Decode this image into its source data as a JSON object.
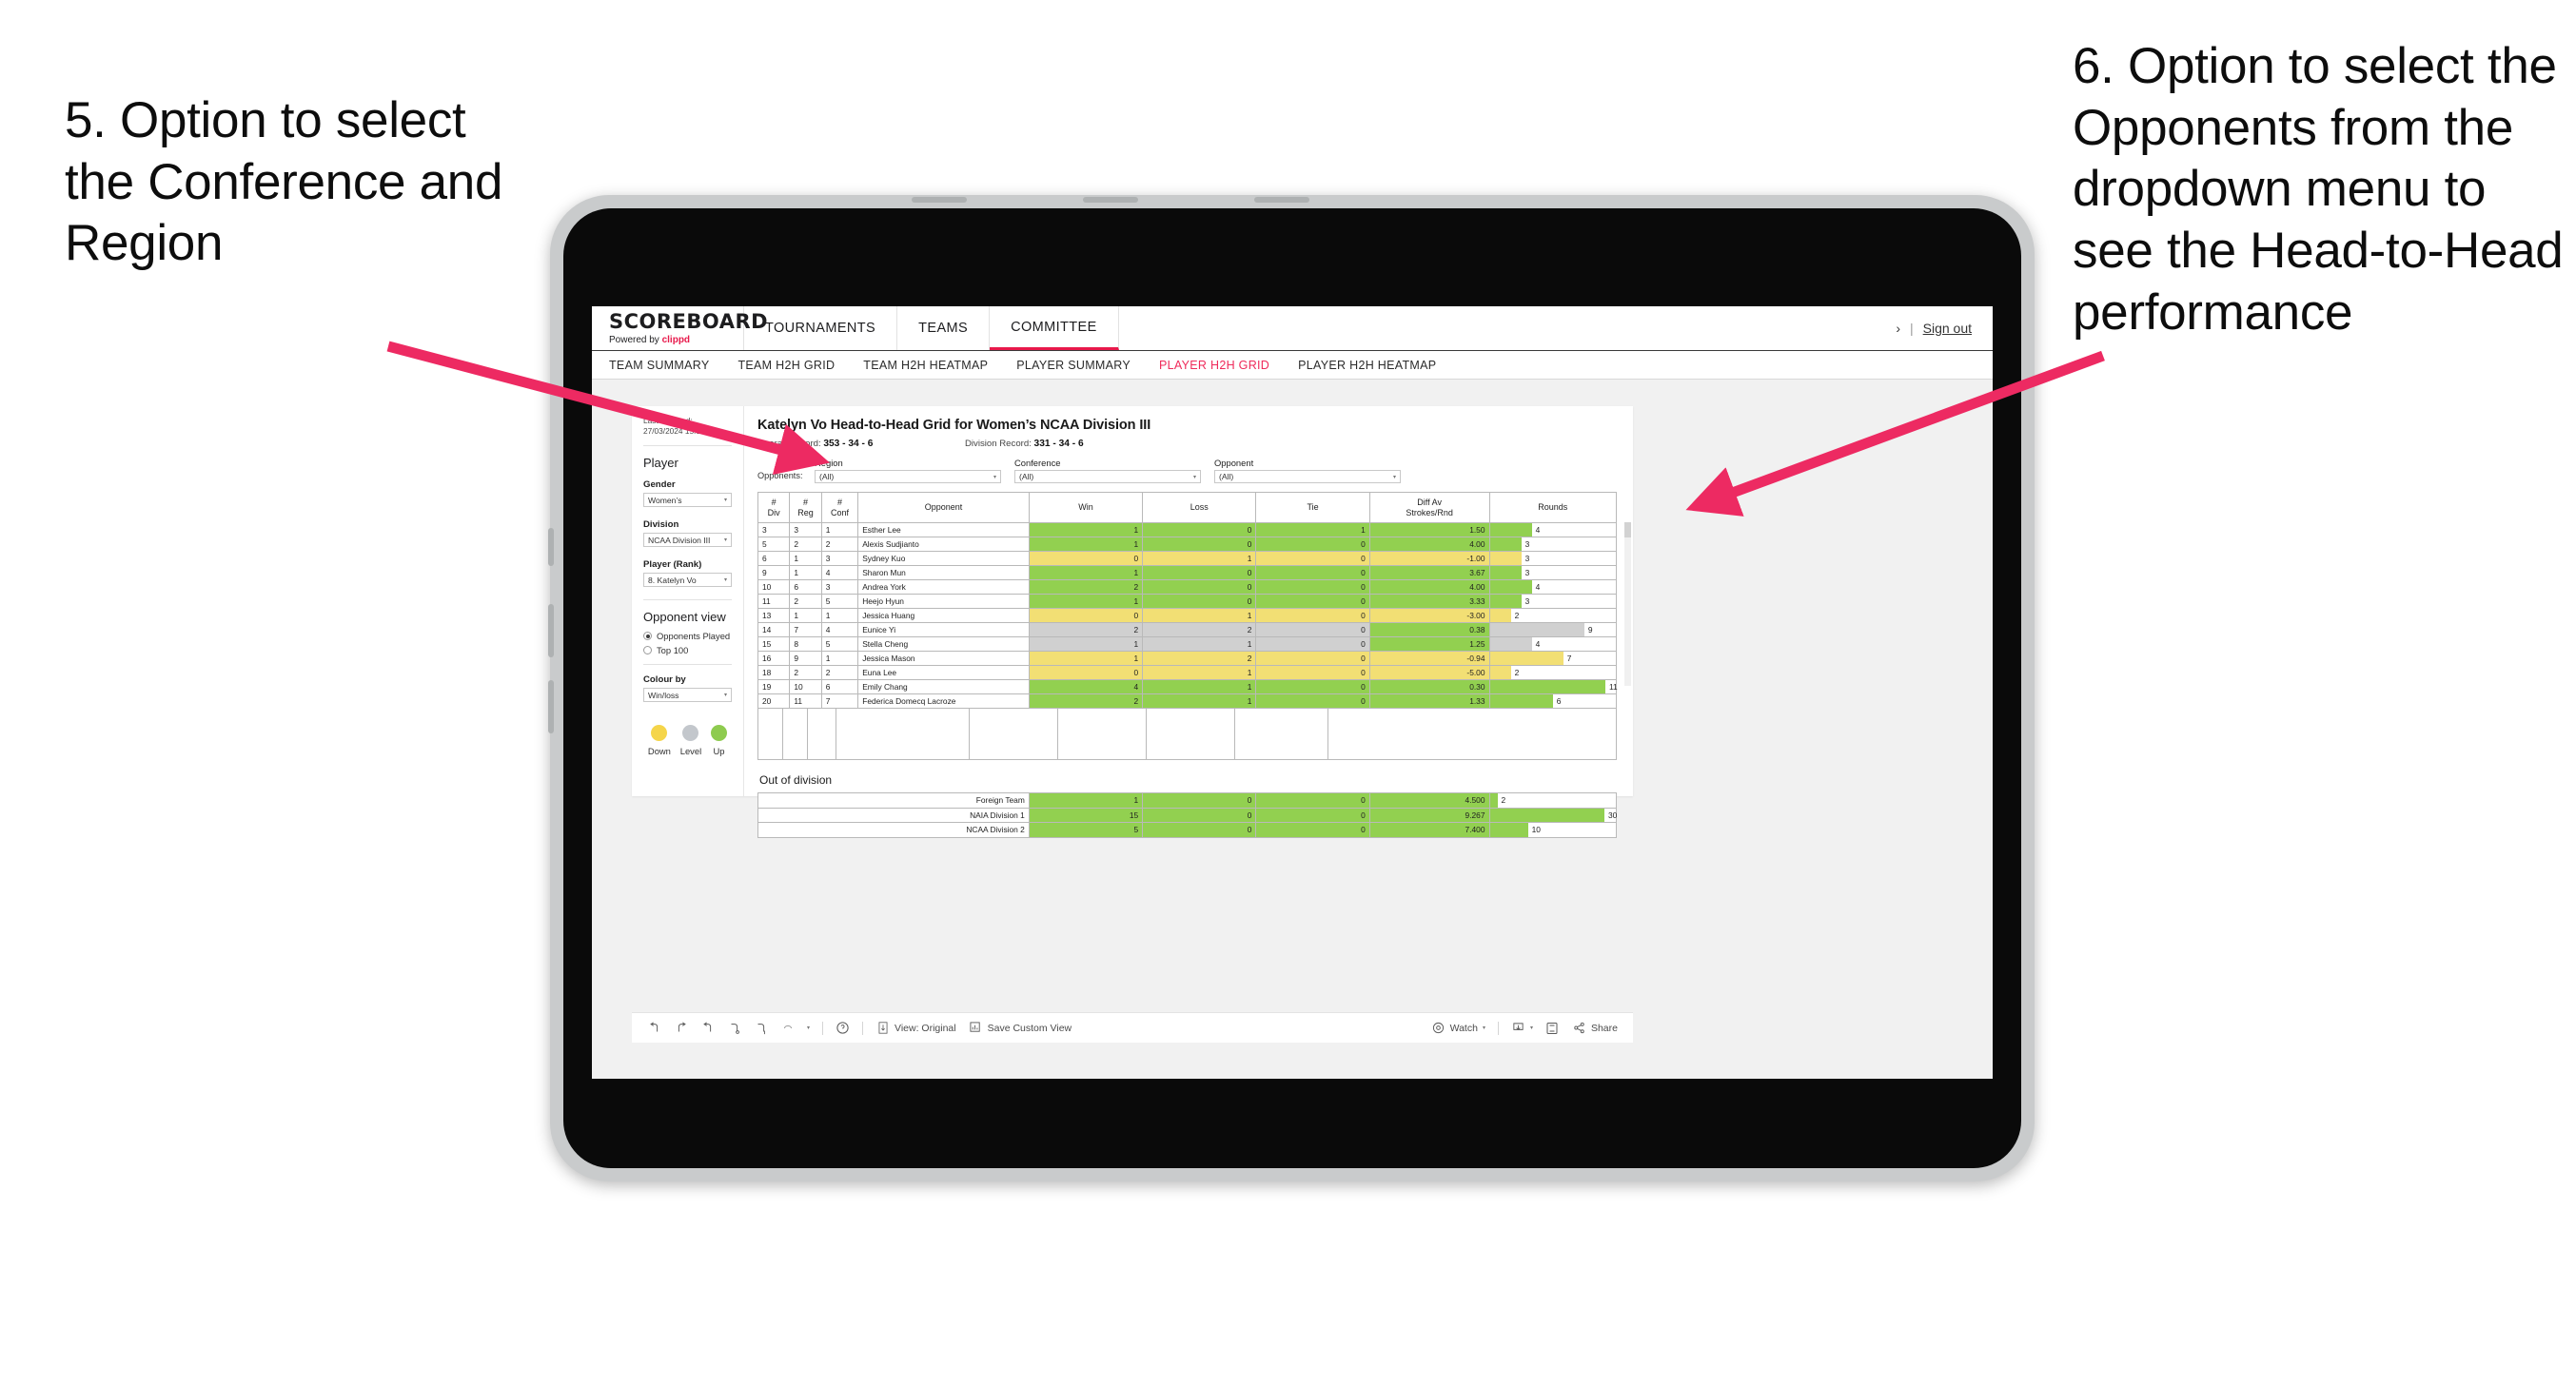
{
  "annotations": {
    "left": "5. Option to select the Conference and Region",
    "right": "6. Option to select the Opponents from the dropdown menu to see the Head-to-Head performance"
  },
  "colors": {
    "accent_pink": "#e8194b",
    "arrow_pink": "#ed2a62",
    "green": "#92d050",
    "yellow": "#f2df74",
    "grey": "#d0d0d0"
  },
  "topnav": {
    "brand_title": "SCOREBOARD",
    "brand_sub_prefix": "Powered by ",
    "brand_sub_name": "clippd",
    "items": [
      {
        "label": "TOURNAMENTS",
        "active": false
      },
      {
        "label": "TEAMS",
        "active": false
      },
      {
        "label": "COMMITTEE",
        "active": true
      }
    ],
    "chevron": "›",
    "separator": "|",
    "signout": "Sign out"
  },
  "subnav": {
    "items": [
      {
        "label": "TEAM SUMMARY",
        "active": false
      },
      {
        "label": "TEAM H2H GRID",
        "active": false
      },
      {
        "label": "TEAM H2H HEATMAP",
        "active": false
      },
      {
        "label": "PLAYER SUMMARY",
        "active": false
      },
      {
        "label": "PLAYER H2H GRID",
        "active": true
      },
      {
        "label": "PLAYER H2H HEATMAP",
        "active": false
      }
    ]
  },
  "sidebar": {
    "last_updated": "Last Updated: 27/03/2024 15:38",
    "player_heading": "Player",
    "gender_label": "Gender",
    "gender_value": "Women’s",
    "division_label": "Division",
    "division_value": "NCAA Division III",
    "player_rank_label": "Player (Rank)",
    "player_rank_value": "8. Katelyn Vo",
    "opponent_view_heading": "Opponent view",
    "opponent_view_options": [
      {
        "label": "Opponents Played",
        "selected": true
      },
      {
        "label": "Top 100",
        "selected": false
      }
    ],
    "colour_by_label": "Colour by",
    "colour_by_value": "Win/loss",
    "legend": [
      {
        "label": "Down",
        "color": "#f5d54a"
      },
      {
        "label": "Level",
        "color": "#c3c7cc"
      },
      {
        "label": "Up",
        "color": "#8ecb4f"
      }
    ],
    "caret": "▾"
  },
  "main": {
    "title": "Katelyn Vo Head-to-Head Grid for Women’s NCAA Division III",
    "overall_record_label": "Overall Record:",
    "overall_record_value": "353 - 34 - 6",
    "division_record_label": "Division Record:",
    "division_record_value": "331 -  34 - 6",
    "opponents_label": "Opponents:",
    "filters": [
      {
        "label": "Region",
        "value": "(All)"
      },
      {
        "label": "Conference",
        "value": "(All)"
      },
      {
        "label": "Opponent",
        "value": "(All)"
      }
    ],
    "out_of_division_title": "Out of division"
  },
  "chart_data": {
    "type": "table",
    "title": "Katelyn Vo Head-to-Head Grid for Women’s NCAA Division III",
    "columns": [
      "# Div",
      "# Reg",
      "# Conf",
      "Opponent",
      "Win",
      "Loss",
      "Tie",
      "Diff Av Strokes/Rnd",
      "Rounds"
    ],
    "column_headers_multiline": [
      {
        "l1": "#",
        "l2": "Div"
      },
      {
        "l1": "#",
        "l2": "Reg"
      },
      {
        "l1": "#",
        "l2": "Conf"
      },
      {
        "l1": "Opponent",
        "l2": ""
      },
      {
        "l1": "Win",
        "l2": ""
      },
      {
        "l1": "Loss",
        "l2": ""
      },
      {
        "l1": "Tie",
        "l2": ""
      },
      {
        "l1": "Diff Av",
        "l2": "Strokes/Rnd"
      },
      {
        "l1": "Rounds",
        "l2": ""
      }
    ],
    "rounds_max": 12,
    "rows": [
      {
        "div": "3",
        "reg": "3",
        "conf": "1",
        "opponent": "Esther Lee",
        "win": "1",
        "loss": "0",
        "tie": "1",
        "diff": "1.50",
        "rounds": "4",
        "rounds_n": 4,
        "color": "green"
      },
      {
        "div": "5",
        "reg": "2",
        "conf": "2",
        "opponent": "Alexis Sudjianto",
        "win": "1",
        "loss": "0",
        "tie": "0",
        "diff": "4.00",
        "rounds": "3",
        "rounds_n": 3,
        "color": "green"
      },
      {
        "div": "6",
        "reg": "1",
        "conf": "3",
        "opponent": "Sydney Kuo",
        "win": "0",
        "loss": "1",
        "tie": "0",
        "diff": "-1.00",
        "rounds": "3",
        "rounds_n": 3,
        "color": "yellow"
      },
      {
        "div": "9",
        "reg": "1",
        "conf": "4",
        "opponent": "Sharon Mun",
        "win": "1",
        "loss": "0",
        "tie": "0",
        "diff": "3.67",
        "rounds": "3",
        "rounds_n": 3,
        "color": "green"
      },
      {
        "div": "10",
        "reg": "6",
        "conf": "3",
        "opponent": "Andrea York",
        "win": "2",
        "loss": "0",
        "tie": "0",
        "diff": "4.00",
        "rounds": "4",
        "rounds_n": 4,
        "color": "green"
      },
      {
        "div": "11",
        "reg": "2",
        "conf": "5",
        "opponent": "Heejo Hyun",
        "win": "1",
        "loss": "0",
        "tie": "0",
        "diff": "3.33",
        "rounds": "3",
        "rounds_n": 3,
        "color": "green"
      },
      {
        "div": "13",
        "reg": "1",
        "conf": "1",
        "opponent": "Jessica Huang",
        "win": "0",
        "loss": "1",
        "tie": "0",
        "diff": "-3.00",
        "rounds": "2",
        "rounds_n": 2,
        "color": "yellow"
      },
      {
        "div": "14",
        "reg": "7",
        "conf": "4",
        "opponent": "Eunice Yi",
        "win": "2",
        "loss": "2",
        "tie": "0",
        "diff": "0.38",
        "rounds": "9",
        "rounds_n": 9,
        "color": "grey",
        "diff_color": "green"
      },
      {
        "div": "15",
        "reg": "8",
        "conf": "5",
        "opponent": "Stella Cheng",
        "win": "1",
        "loss": "1",
        "tie": "0",
        "diff": "1.25",
        "rounds": "4",
        "rounds_n": 4,
        "color": "grey",
        "diff_color": "green"
      },
      {
        "div": "16",
        "reg": "9",
        "conf": "1",
        "opponent": "Jessica Mason",
        "win": "1",
        "loss": "2",
        "tie": "0",
        "diff": "-0.94",
        "rounds": "7",
        "rounds_n": 7,
        "color": "yellow"
      },
      {
        "div": "18",
        "reg": "2",
        "conf": "2",
        "opponent": "Euna Lee",
        "win": "0",
        "loss": "1",
        "tie": "0",
        "diff": "-5.00",
        "rounds": "2",
        "rounds_n": 2,
        "color": "yellow"
      },
      {
        "div": "19",
        "reg": "10",
        "conf": "6",
        "opponent": "Emily Chang",
        "win": "4",
        "loss": "1",
        "tie": "0",
        "diff": "0.30",
        "rounds": "11",
        "rounds_n": 11,
        "color": "green"
      },
      {
        "div": "20",
        "reg": "11",
        "conf": "7",
        "opponent": "Federica Domecq Lacroze",
        "win": "2",
        "loss": "1",
        "tie": "0",
        "diff": "1.33",
        "rounds": "6",
        "rounds_n": 6,
        "color": "green"
      }
    ],
    "out_of_division_rows": [
      {
        "name": "Foreign Team",
        "win": "1",
        "loss": "0",
        "tie": "0",
        "diff": "4.500",
        "rounds": "2",
        "rounds_n": 2,
        "color": "green"
      },
      {
        "name": "NAIA Division 1",
        "win": "15",
        "loss": "0",
        "tie": "0",
        "diff": "9.267",
        "rounds": "30",
        "rounds_n": 30,
        "color": "green"
      },
      {
        "name": "NCAA Division 2",
        "win": "5",
        "loss": "0",
        "tie": "0",
        "diff": "7.400",
        "rounds": "10",
        "rounds_n": 10,
        "color": "green"
      }
    ],
    "out_of_division_rounds_max": 33
  },
  "toolbar": {
    "view_label": "View: Original",
    "save_label": "Save Custom View",
    "watch_label": "Watch",
    "share_label": "Share",
    "caret": "▾"
  }
}
